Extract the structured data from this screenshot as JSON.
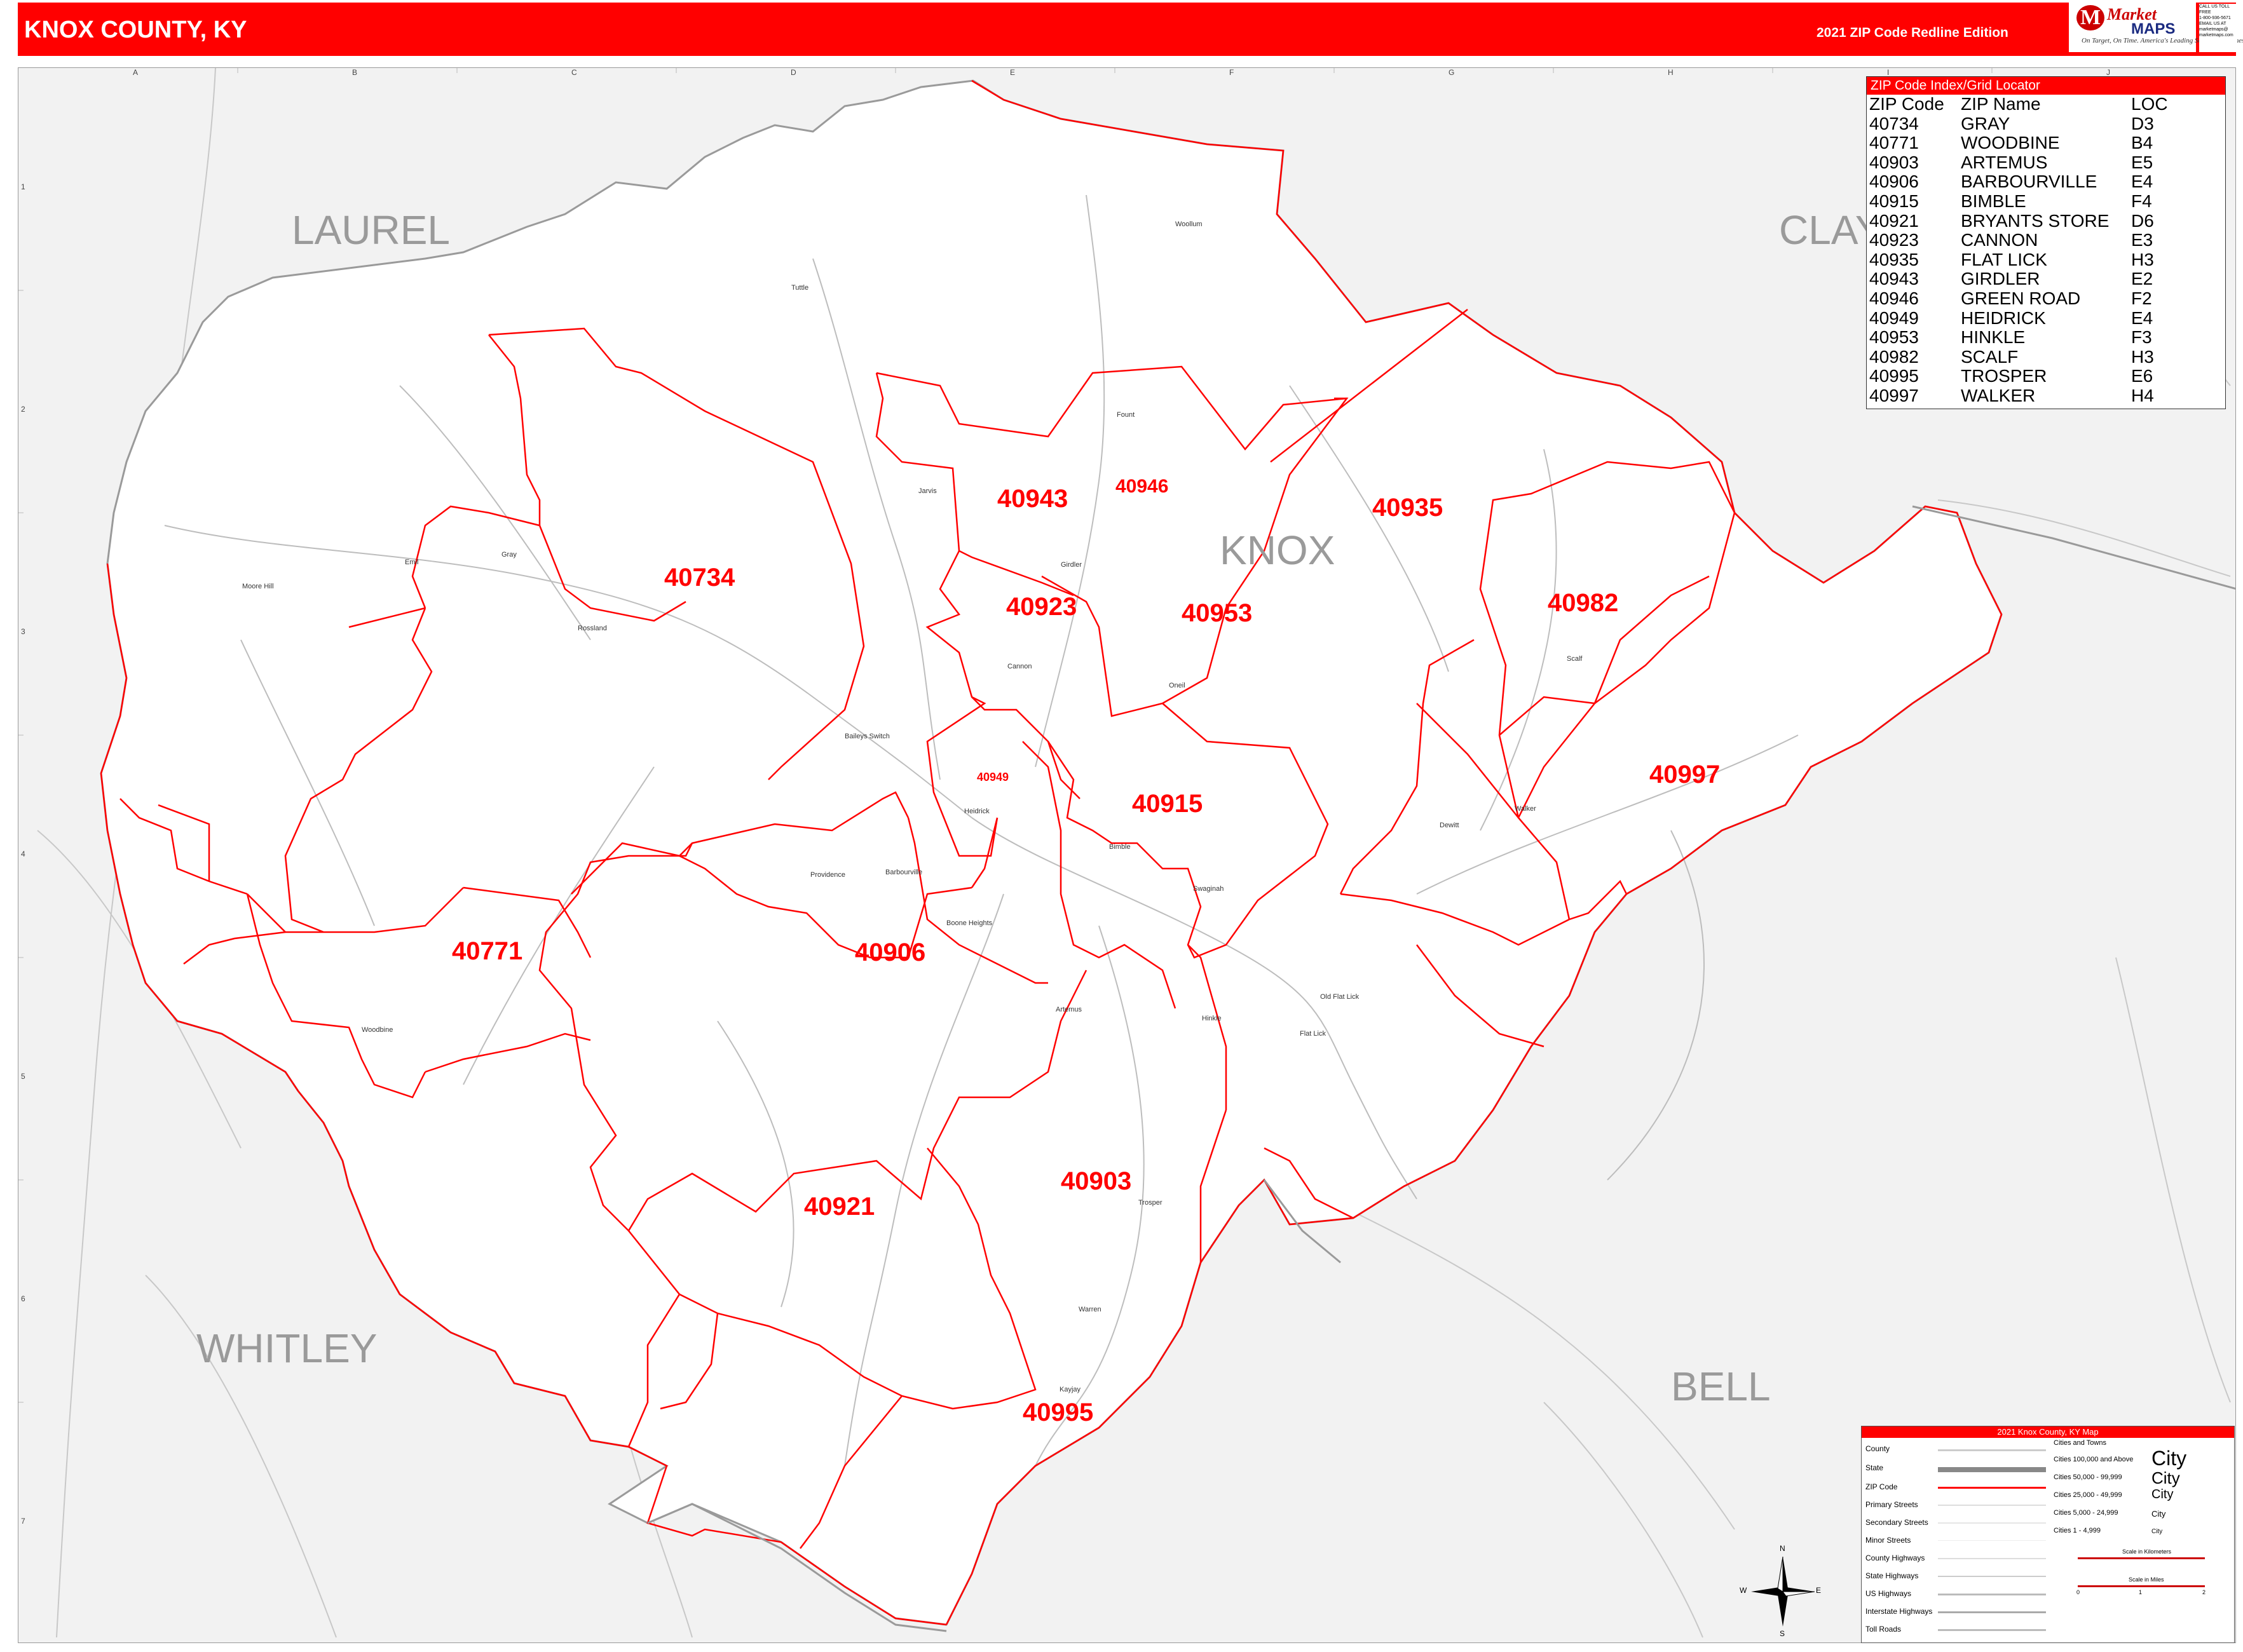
{
  "header": {
    "title": "KNOX COUNTY, KY",
    "edition": "2021 ZIP Code Redline Edition",
    "logo_market": "Market",
    "logo_maps": "MAPS",
    "logo_tagline": "On Target, On Time. America's Leading Source of Business Maps",
    "contact_lines": [
      "CALL US TOLL FREE",
      "1-800-936-5671",
      "EMAIL US AT",
      "marketmaps@",
      "marketmaps.com"
    ]
  },
  "grid": {
    "columns": [
      "A",
      "B",
      "C",
      "D",
      "E",
      "F",
      "G",
      "H",
      "I",
      "J"
    ],
    "rows": [
      "1",
      "2",
      "3",
      "4",
      "5",
      "6",
      "7"
    ]
  },
  "counties": {
    "focus": "KNOX",
    "neighbors": [
      "LAUREL",
      "CLAY",
      "WHITLEY",
      "BELL"
    ]
  },
  "zip_labels": [
    "40734",
    "40771",
    "40903",
    "40906",
    "40915",
    "40921",
    "40923",
    "40935",
    "40943",
    "40946",
    "40949",
    "40953",
    "40982",
    "40995",
    "40997"
  ],
  "cities": [
    "Woollum",
    "Tuttle",
    "Fount",
    "Jarvis",
    "Girdler",
    "Gray",
    "Emil",
    "Moore Hill",
    "Rossland",
    "Cannon",
    "Scalf",
    "Walker",
    "Oneil",
    "Baileys Switch",
    "Heidrick",
    "Bimble",
    "Providence",
    "Barbourville",
    "Boone Heights",
    "Swaginah",
    "Dewitt",
    "Warren",
    "Artemus",
    "Trosper",
    "Old Flat Lick",
    "Flat Lick",
    "Hinkle",
    "Kayjay",
    "Woodbine"
  ],
  "index": {
    "title": "ZIP Code Index/Grid Locator",
    "headers": [
      "ZIP Code",
      "ZIP Name",
      "LOC"
    ],
    "rows": [
      [
        "40734",
        "GRAY",
        "D3"
      ],
      [
        "40771",
        "WOODBINE",
        "B4"
      ],
      [
        "40903",
        "ARTEMUS",
        "E5"
      ],
      [
        "40906",
        "BARBOURVILLE",
        "E4"
      ],
      [
        "40915",
        "BIMBLE",
        "F4"
      ],
      [
        "40921",
        "BRYANTS STORE",
        "D6"
      ],
      [
        "40923",
        "CANNON",
        "E3"
      ],
      [
        "40935",
        "FLAT LICK",
        "H3"
      ],
      [
        "40943",
        "GIRDLER",
        "E2"
      ],
      [
        "40946",
        "GREEN ROAD",
        "F2"
      ],
      [
        "40949",
        "HEIDRICK",
        "E4"
      ],
      [
        "40953",
        "HINKLE",
        "F3"
      ],
      [
        "40982",
        "SCALF",
        "H3"
      ],
      [
        "40995",
        "TROSPER",
        "E6"
      ],
      [
        "40997",
        "WALKER",
        "H4"
      ]
    ]
  },
  "legend": {
    "title": "2021 Knox County, KY Map",
    "items": [
      "County",
      "State",
      "ZIP Code",
      "Primary Streets",
      "Secondary Streets",
      "Minor Streets",
      "County Highways",
      "State Highways",
      "US Highways",
      "Interstate Highways",
      "Toll Roads"
    ],
    "cities_title": "Cities and Towns",
    "city_classes": [
      "Cities 100,000 and Above",
      "Cities 50,000 - 99,999",
      "Cities 25,000 - 49,999",
      "Cities 5,000 - 24,999",
      "Cities 1 - 4,999"
    ],
    "city_sample": "City",
    "scale_km": "Scale in Kilometers",
    "scale_mi": "Scale in Miles",
    "scale_ticks": [
      "0",
      "1",
      "2"
    ]
  },
  "compass": [
    "N",
    "S",
    "E",
    "W"
  ],
  "colors": {
    "header": "#ff0000",
    "zip_line": "#ff0000",
    "county_fill": "#ffffff",
    "background": "#f2f2f2",
    "neighbor_text": "#9a9a9a"
  }
}
